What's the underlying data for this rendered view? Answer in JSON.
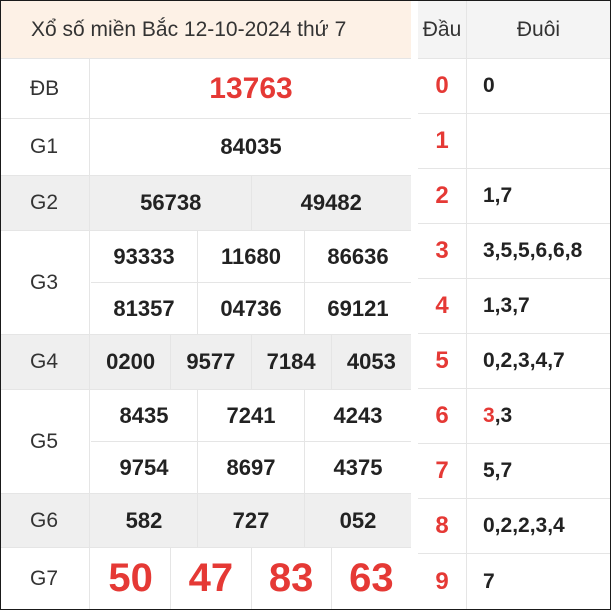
{
  "title": "Xổ số miền Bắc 12-10-2024 thứ 7",
  "prizes": {
    "db": {
      "label": "ĐB",
      "numbers": [
        "13763"
      ]
    },
    "g1": {
      "label": "G1",
      "numbers": [
        "84035"
      ]
    },
    "g2": {
      "label": "G2",
      "numbers": [
        "56738",
        "49482"
      ]
    },
    "g3": {
      "label": "G3",
      "numbers": [
        "93333",
        "11680",
        "86636",
        "81357",
        "04736",
        "69121"
      ]
    },
    "g4": {
      "label": "G4",
      "numbers": [
        "0200",
        "9577",
        "7184",
        "4053"
      ]
    },
    "g5": {
      "label": "G5",
      "numbers": [
        "8435",
        "7241",
        "4243",
        "9754",
        "8697",
        "4375"
      ]
    },
    "g6": {
      "label": "G6",
      "numbers": [
        "582",
        "727",
        "052"
      ]
    },
    "g7": {
      "label": "G7",
      "numbers": [
        "50",
        "47",
        "83",
        "63"
      ]
    }
  },
  "loto": {
    "head_label": "Đầu",
    "tail_label": "Đuôi",
    "rows": [
      {
        "head": "0",
        "tails": "0"
      },
      {
        "head": "1",
        "tails": ""
      },
      {
        "head": "2",
        "tails": "1,7"
      },
      {
        "head": "3",
        "tails": "3,5,5,6,6,8"
      },
      {
        "head": "4",
        "tails": "1,3,7"
      },
      {
        "head": "5",
        "tails": "0,2,3,4,7"
      },
      {
        "head": "6",
        "tails_highlight": "3",
        "tails_rest": ",3"
      },
      {
        "head": "7",
        "tails": "5,7"
      },
      {
        "head": "8",
        "tails": "0,2,2,3,4"
      },
      {
        "head": "9",
        "tails": "7"
      }
    ]
  },
  "colors": {
    "accent_red": "#e53935",
    "title_bg": "#fdf1e6",
    "shade_bg": "#efefef"
  }
}
